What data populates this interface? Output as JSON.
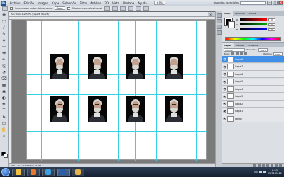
{
  "menubar": {
    "logo": "Ps",
    "items": [
      "Archivo",
      "Edición",
      "Imagen",
      "Capa",
      "Selección",
      "Filtro",
      "Análisis",
      "3D",
      "Vista",
      "Ventana",
      "Ayuda"
    ],
    "zoom": "67%",
    "workspace": "Aspectos esenciales",
    "search_placeholder": "",
    "window_buttons": [
      "–",
      "□",
      "×"
    ]
  },
  "optionsbar": {
    "auto_select_label": "Seleccionar automáticamente",
    "auto_select_value": "Capa",
    "show_controls_label": "Mostrar controles transf."
  },
  "document": {
    "tab_label": "Sin título-1 al 50% (Capa 8, RGB/8) *",
    "tab_close": "×"
  },
  "statusbar": {
    "zoom": "50%",
    "doc_info": "Doc: 24,9 MB/8,16 MB"
  },
  "color_panel": {
    "tabs": [
      "Color",
      "Muestras",
      "Estilos"
    ],
    "sliders": [
      {
        "label": "R",
        "value": "0",
        "color": "#ff0000"
      },
      {
        "label": "G",
        "value": "0",
        "color": "#00aa00"
      },
      {
        "label": "B",
        "value": "0",
        "color": "#0000ff"
      }
    ]
  },
  "layers_panel": {
    "tabs": [
      "Capas",
      "Canales",
      "Trazados"
    ],
    "blend_mode": "Normal",
    "opacity_label": "Opacidad:",
    "opacity_value": "100%",
    "lock_label": "Bloq.:",
    "fill_label": "Relleno:",
    "fill_value": "100%",
    "layers": [
      {
        "name": "Capa 8",
        "selected": true
      },
      {
        "name": "Capa 7",
        "selected": false
      },
      {
        "name": "Capa 6",
        "selected": false
      },
      {
        "name": "Capa 5",
        "selected": false
      },
      {
        "name": "Capa 4",
        "selected": false
      },
      {
        "name": "Capa 3",
        "selected": false
      },
      {
        "name": "Capa 2",
        "selected": false
      },
      {
        "name": "Capa 1",
        "selected": false
      },
      {
        "name": "Fondo",
        "selected": false
      }
    ]
  },
  "tools": [
    "move-tool",
    "marquee-tool",
    "lasso-tool",
    "quick-select-tool",
    "crop-tool",
    "eyedropper-tool",
    "healing-brush-tool",
    "brush-tool",
    "clone-stamp-tool",
    "history-brush-tool",
    "eraser-tool",
    "gradient-tool",
    "blur-tool",
    "dodge-tool",
    "pen-tool",
    "type-tool",
    "path-select-tool",
    "shape-tool",
    "hand-tool",
    "zoom-tool"
  ],
  "taskbar": {
    "apps": [
      "explorer",
      "firefox",
      "media-player",
      "photoshop",
      "folder"
    ],
    "language": "ES",
    "time": "9:50",
    "date": "05/01/2011"
  },
  "photos": {
    "count": 8,
    "subject": "portrait-elderly-man-white-hair-beard"
  }
}
